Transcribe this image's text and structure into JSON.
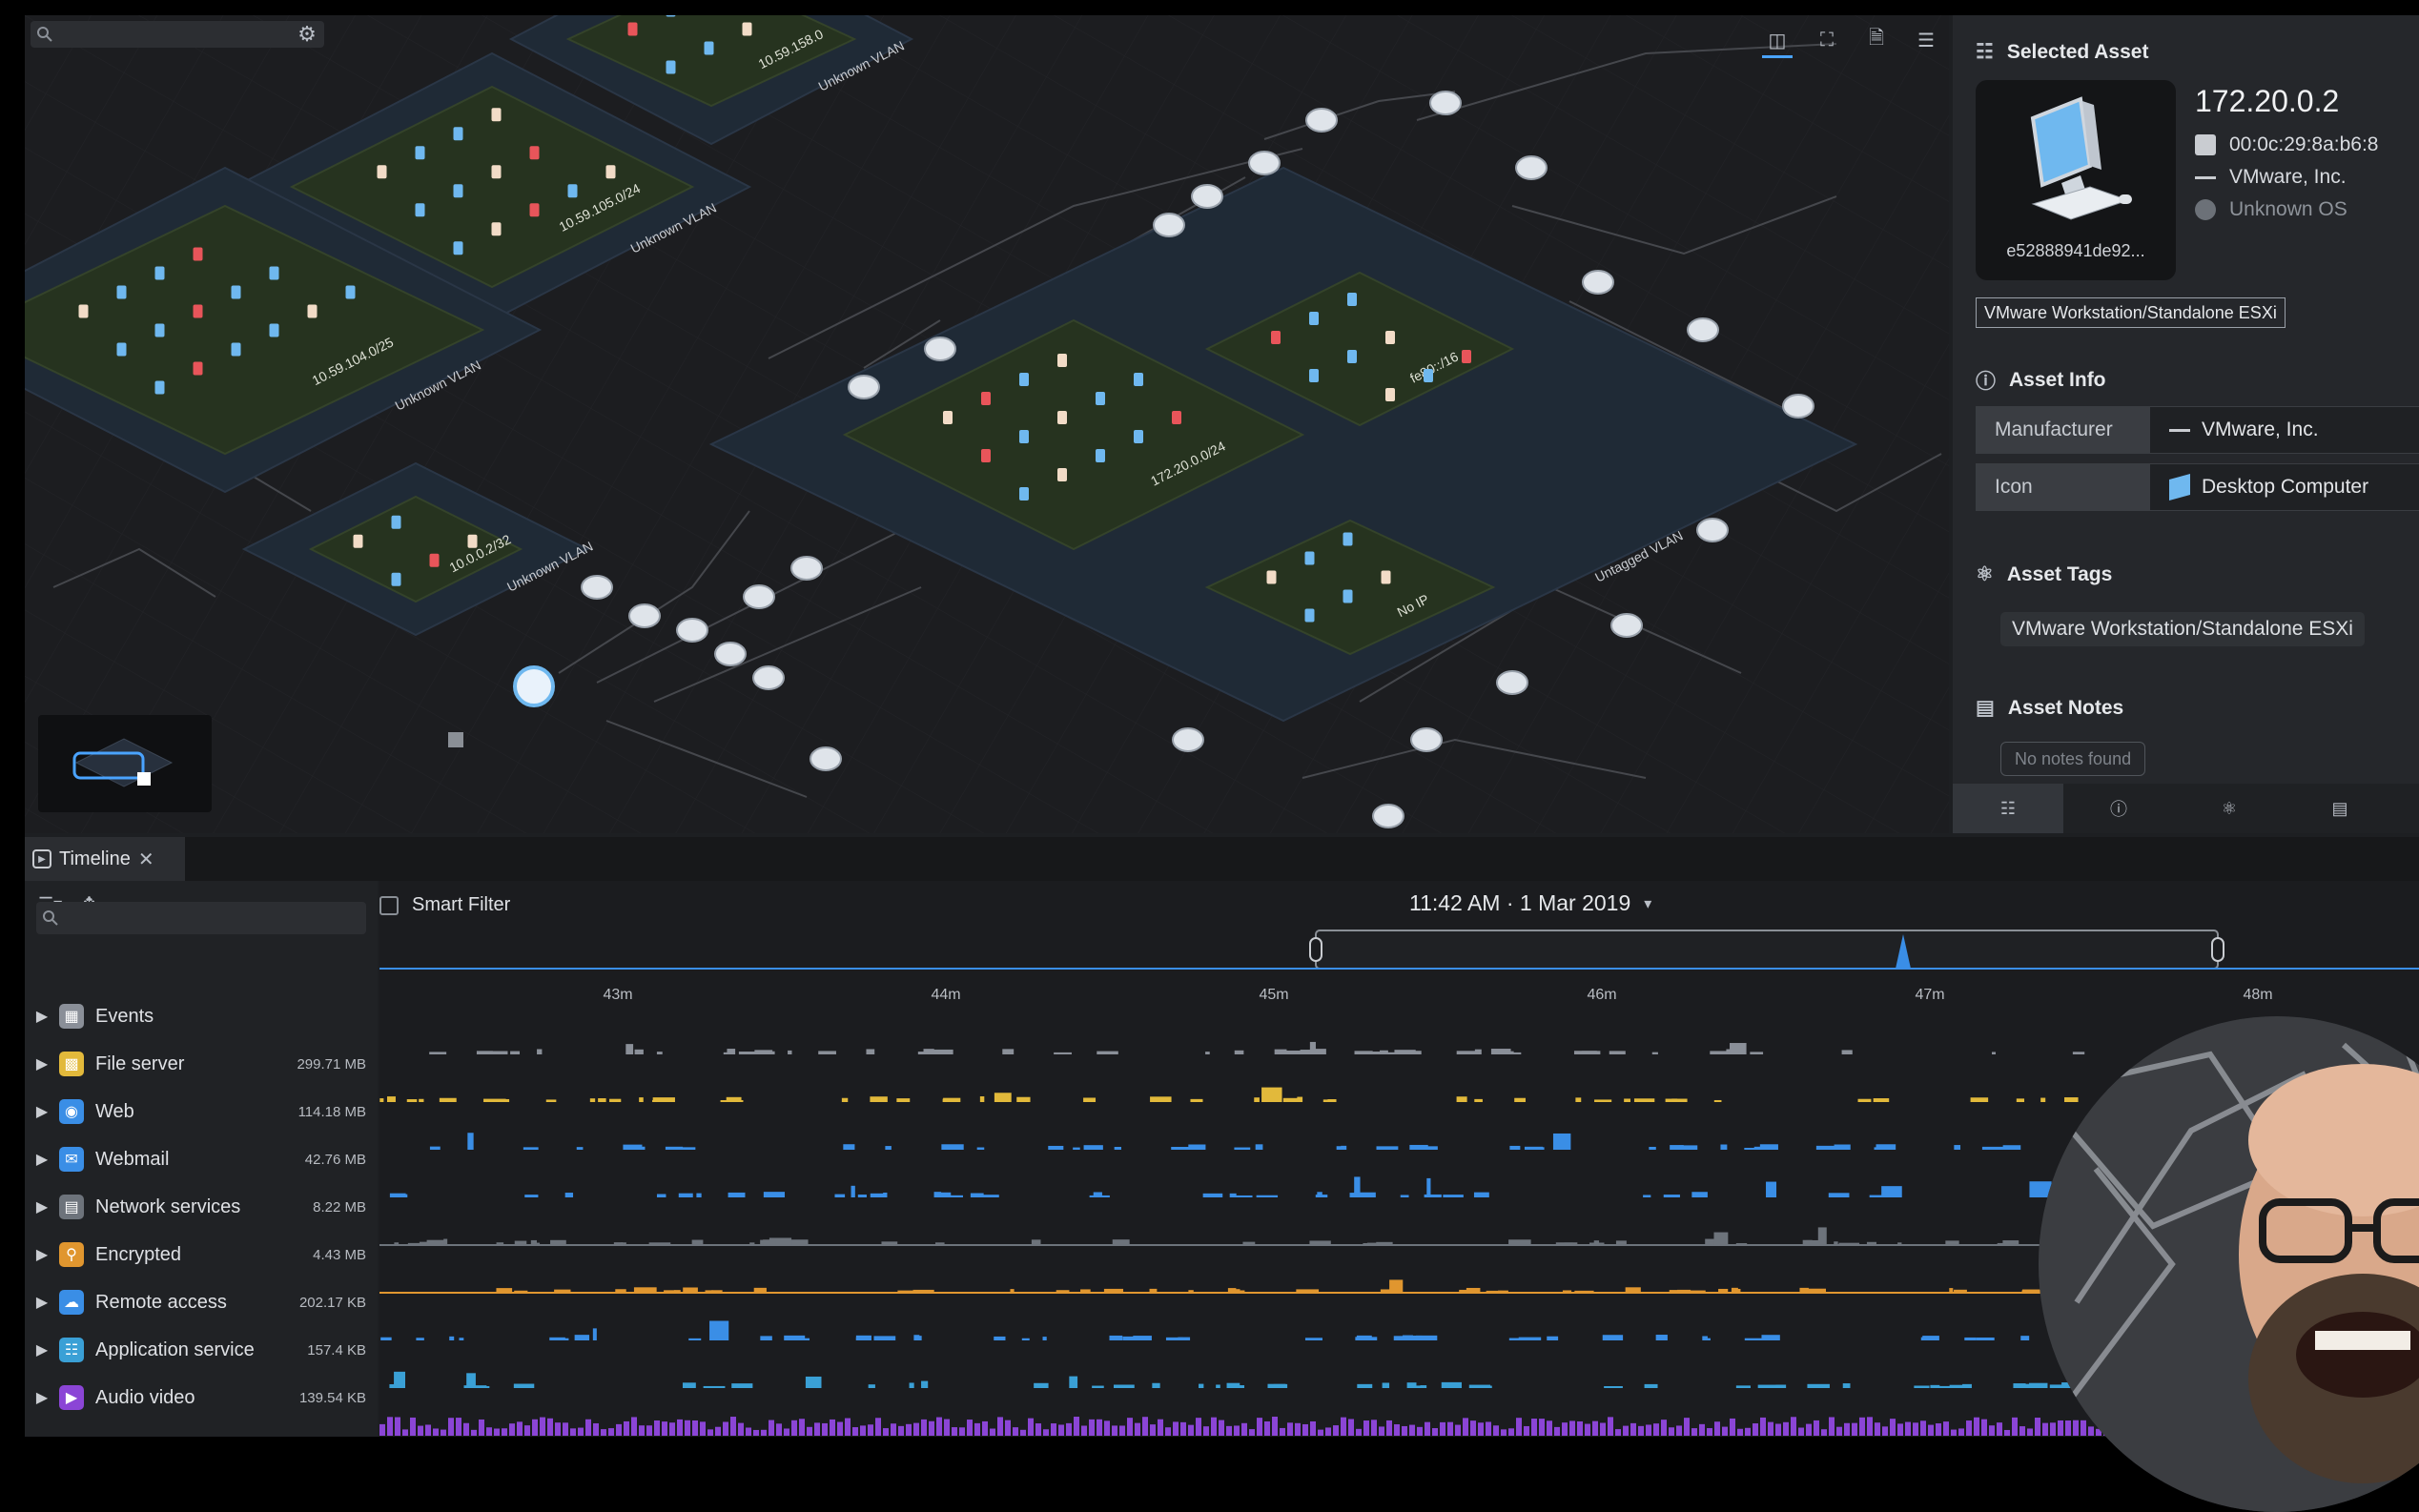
{
  "map": {
    "search": {
      "placeholder": "",
      "value": ""
    },
    "subnets": [
      {
        "label": "10.59.158.0",
        "vlan": "Unknown VLAN"
      },
      {
        "label": "10.59.105.0/24",
        "vlan": "Unknown VLAN"
      },
      {
        "label": "10.59.104.0/25",
        "vlan": "Unknown VLAN"
      },
      {
        "label": "10.0.0.2/32",
        "vlan": "Unknown VLAN"
      },
      {
        "label": "172.20.0.0/24",
        "vlan": "Untagged VLAN"
      },
      {
        "label": "fe80::/16",
        "vlan": ""
      },
      {
        "label": "No IP",
        "vlan": ""
      }
    ],
    "icons": {
      "settings": "gear-icon",
      "layout": "topology-icon",
      "fit": "fit-screen-icon",
      "export": "export-file-icon",
      "filter": "filter-list-icon"
    }
  },
  "panel": {
    "selected_title": "Selected Asset",
    "asset_id": "e52888941de92...",
    "ip": "172.20.0.2",
    "mac": "00:0c:29:8a:b6:8",
    "vendor": "VMware, Inc.",
    "os": "Unknown OS",
    "tag_badge": "VMware Workstation/Standalone ESXi",
    "info_title": "Asset Info",
    "info_rows": [
      {
        "key": "Manufacturer",
        "value": "VMware, Inc."
      },
      {
        "key": "Icon",
        "value": "Desktop Computer"
      }
    ],
    "tags_title": "Asset Tags",
    "tag": "VMware Workstation/Standalone ESXi",
    "notes_title": "Asset Notes",
    "notes_empty": "No notes found"
  },
  "timeline": {
    "tab_label": "Timeline",
    "smart_filter": "Smart Filter",
    "date": "11:42 AM · 1 Mar 2019",
    "ticks": [
      "43m",
      "44m",
      "45m",
      "46m",
      "47m",
      "48m"
    ],
    "search_placeholder": "",
    "categories": [
      {
        "name": "Events",
        "size": "",
        "color": "#8a8f98"
      },
      {
        "name": "File server",
        "size": "299.71 MB",
        "color": "#e2b93b"
      },
      {
        "name": "Web",
        "size": "114.18 MB",
        "color": "#3a8ee6"
      },
      {
        "name": "Webmail",
        "size": "42.76 MB",
        "color": "#3a8ee6"
      },
      {
        "name": "Network services",
        "size": "8.22 MB",
        "color": "#6d737b"
      },
      {
        "name": "Encrypted",
        "size": "4.43 MB",
        "color": "#e0962f"
      },
      {
        "name": "Remote access",
        "size": "202.17 KB",
        "color": "#3a8ee6"
      },
      {
        "name": "Application service",
        "size": "157.4 KB",
        "color": "#3aa0d6"
      },
      {
        "name": "Audio video",
        "size": "139.54 KB",
        "color": "#8b45d6"
      }
    ]
  },
  "colors": {
    "accent": "#4aa3ff",
    "subnet_fill": "#26331f",
    "vlan_fill": "#1f2a36"
  }
}
